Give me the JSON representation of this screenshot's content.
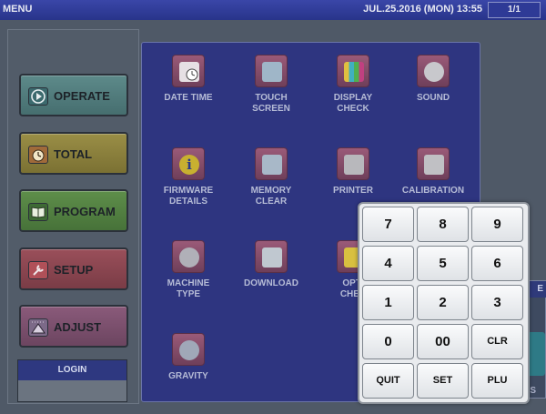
{
  "header": {
    "title": "MENU",
    "datetime": "JUL.25.2016 (MON)  13:55",
    "page": "1/1"
  },
  "left_menu": [
    {
      "label": "OPERATE",
      "icon": "play-icon"
    },
    {
      "label": "TOTAL",
      "icon": "timer-icon"
    },
    {
      "label": "PROGRAM",
      "icon": "book-icon"
    },
    {
      "label": "SETUP",
      "icon": "wrench-icon"
    },
    {
      "label": "ADJUST",
      "icon": "level-icon"
    }
  ],
  "login": {
    "label": "LOGIN"
  },
  "menu_items": [
    {
      "label1": "DATE TIME",
      "label2": ""
    },
    {
      "label1": "TOUCH",
      "label2": "SCREEN"
    },
    {
      "label1": "DISPLAY",
      "label2": "CHECK"
    },
    {
      "label1": "SOUND",
      "label2": ""
    },
    {
      "label1": "FIRMWARE",
      "label2": "DETAILS"
    },
    {
      "label1": "MEMORY",
      "label2": "CLEAR"
    },
    {
      "label1": "PRINTER",
      "label2": ""
    },
    {
      "label1": "CALIBRATION",
      "label2": ""
    },
    {
      "label1": "MACHINE",
      "label2": "TYPE"
    },
    {
      "label1": "DOWNLOAD",
      "label2": ""
    },
    {
      "label1": "OPTI",
      "label2": "CHEC"
    },
    {
      "label1": "GRAVITY",
      "label2": ""
    }
  ],
  "side_panel": {
    "tab_text": "E",
    "footer_text": "S"
  },
  "keypad": {
    "keys": [
      "7",
      "8",
      "9",
      "4",
      "5",
      "6",
      "1",
      "2",
      "3",
      "0",
      "00",
      "CLR",
      "QUIT",
      "SET",
      "PLU"
    ]
  }
}
